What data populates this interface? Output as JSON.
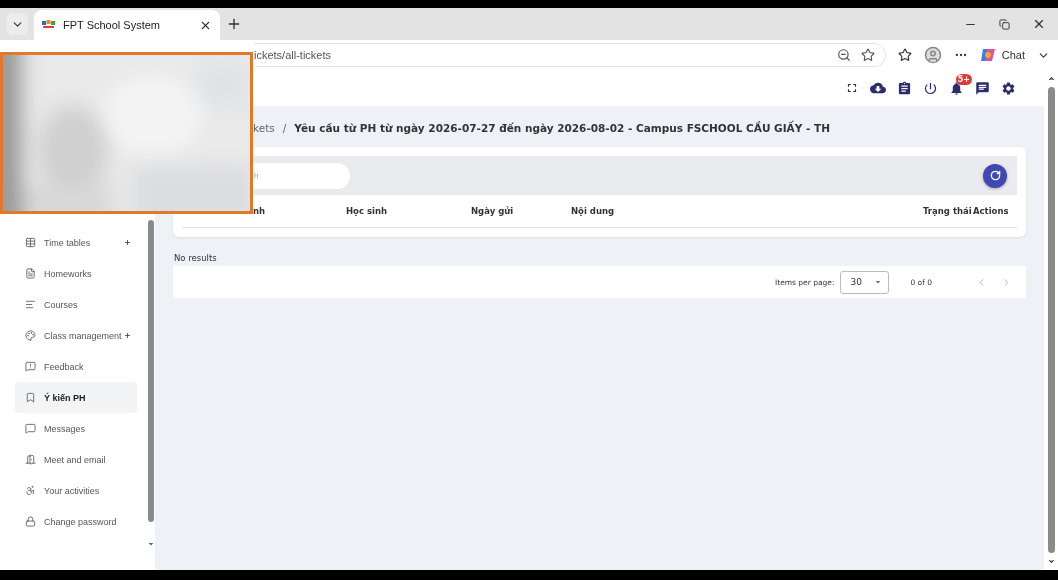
{
  "browser": {
    "tab_title": "FPT School System",
    "url": "ickets/all-tickets",
    "assistant_label": "Chat"
  },
  "header": {
    "notification_badge": "5+"
  },
  "sidebar": {
    "items": [
      {
        "label": "Time tables",
        "expandable": true,
        "selected": false
      },
      {
        "label": "Homeworks",
        "expandable": false,
        "selected": false
      },
      {
        "label": "Courses",
        "expandable": false,
        "selected": false
      },
      {
        "label": "Class management",
        "expandable": true,
        "selected": false
      },
      {
        "label": "Feedback",
        "expandable": false,
        "selected": false
      },
      {
        "label": "Ý kiến PH",
        "expandable": false,
        "selected": true
      },
      {
        "label": "Messages",
        "expandable": false,
        "selected": false
      },
      {
        "label": "Meet and email",
        "expandable": false,
        "selected": false
      },
      {
        "label": "Your activities",
        "expandable": false,
        "selected": false
      },
      {
        "label": "Change password",
        "expandable": false,
        "selected": false
      }
    ]
  },
  "breadcrumb": {
    "parent": "kets",
    "separator": "/",
    "current": "Yêu cầu từ PH từ ngày 2026-07-27 đến ngày 2026-08-02 - Campus FSCHOOL CẦU GIẤY - TH"
  },
  "search": {
    "placeholder": "h"
  },
  "table": {
    "columns": [
      "nh",
      "Học sinh",
      "Ngày gửi",
      "Nội dung",
      "Trạng thái",
      "Actions"
    ],
    "empty_text": "No results"
  },
  "pagination": {
    "label": "Items per page:",
    "page_size": "30",
    "range": "0 of 0"
  }
}
